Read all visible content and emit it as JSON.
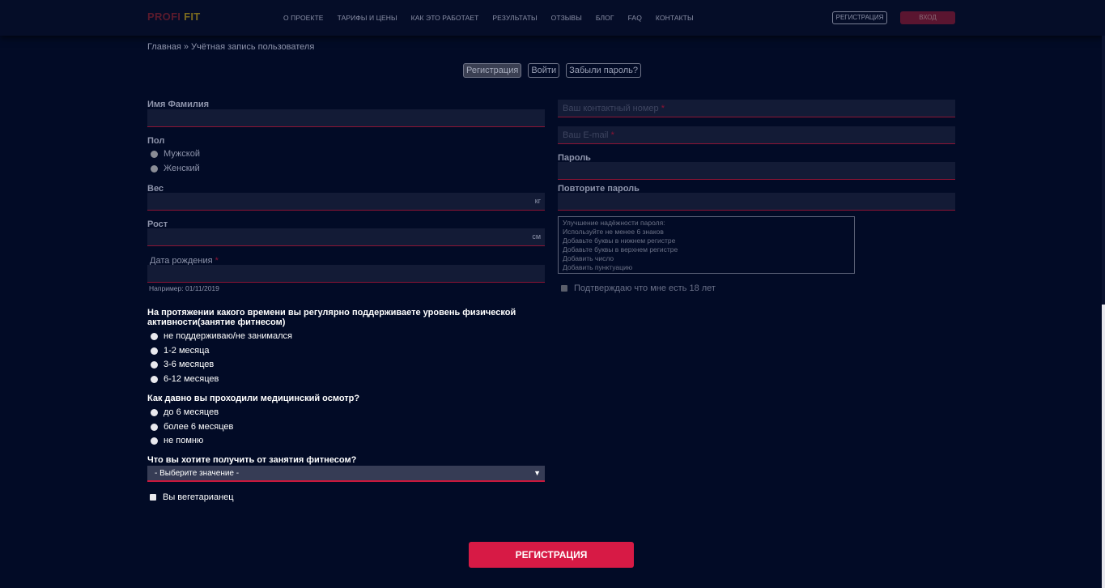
{
  "header": {
    "logo_part1": "PROFI",
    "logo_part2": "FIT",
    "nav": [
      "О ПРОЕКТЕ",
      "ТАРИФЫ И ЦЕНЫ",
      "КАК ЭТО РАБОТАЕТ",
      "РЕЗУЛЬТАТЫ",
      "ОТЗЫВЫ",
      "БЛОГ",
      "FAQ",
      "КОНТАКТЫ"
    ],
    "register_label": "РЕГИСТРАЦИЯ",
    "login_label": "ВХОД"
  },
  "breadcrumb": {
    "home": "Главная",
    "separator": "»",
    "current": "Учётная запись пользователя"
  },
  "tabs": [
    "Регистрация",
    "Войти",
    "Забыли пароль?"
  ],
  "form_left": {
    "name_label": "Имя Фамилия",
    "gender_label": "Пол",
    "gender_options": [
      "Мужской",
      "Женский"
    ],
    "weight_label": "Вес",
    "weight_unit": "кг",
    "height_label": "Рост",
    "height_unit": "см",
    "dob_label": "Дата рождения",
    "dob_required": "*",
    "dob_hint": "Например: 01/11/2019",
    "activity_question": "На протяжении какого времени вы регулярно поддерживаете уровень физической активности(занятие фитнесом)",
    "activity_options": [
      "не поддерживаю/не занимался",
      "1-2 месяца",
      "3-6 месяцев",
      "6-12 месяцев"
    ],
    "medical_question": "Как давно вы проходили медицинский осмотр?",
    "medical_options": [
      "до 6 месяцев",
      "более 6 месяцев",
      "не помню"
    ],
    "goal_question": "Что вы хотите получить от занятия фитнесом?",
    "goal_select_value": "- Выберите значение -",
    "vegetarian_label": "Вы вегетарианец"
  },
  "form_right": {
    "phone_placeholder": "Ваш контактный номер",
    "email_placeholder": "Ваш E-mail",
    "required_mark": "*",
    "password_label": "Пароль",
    "password_repeat_label": "Повторите пароль",
    "password_tips_title": "Улучшение надёжности пароля:",
    "password_tips": [
      "Используйте не менее 6 знаков",
      "Добавьте буквы в нижнем регистре",
      "Добавьте буквы в верхнем регистре",
      "Добавить число",
      "Добавить пунктуацию"
    ],
    "age_confirm_label": "Подтверждаю что мне есть 18 лет"
  },
  "submit_label": "РЕГИСТРАЦИЯ",
  "colors": {
    "background": "#020b26",
    "accent": "#d71a45",
    "field_bg": "#131b36"
  }
}
